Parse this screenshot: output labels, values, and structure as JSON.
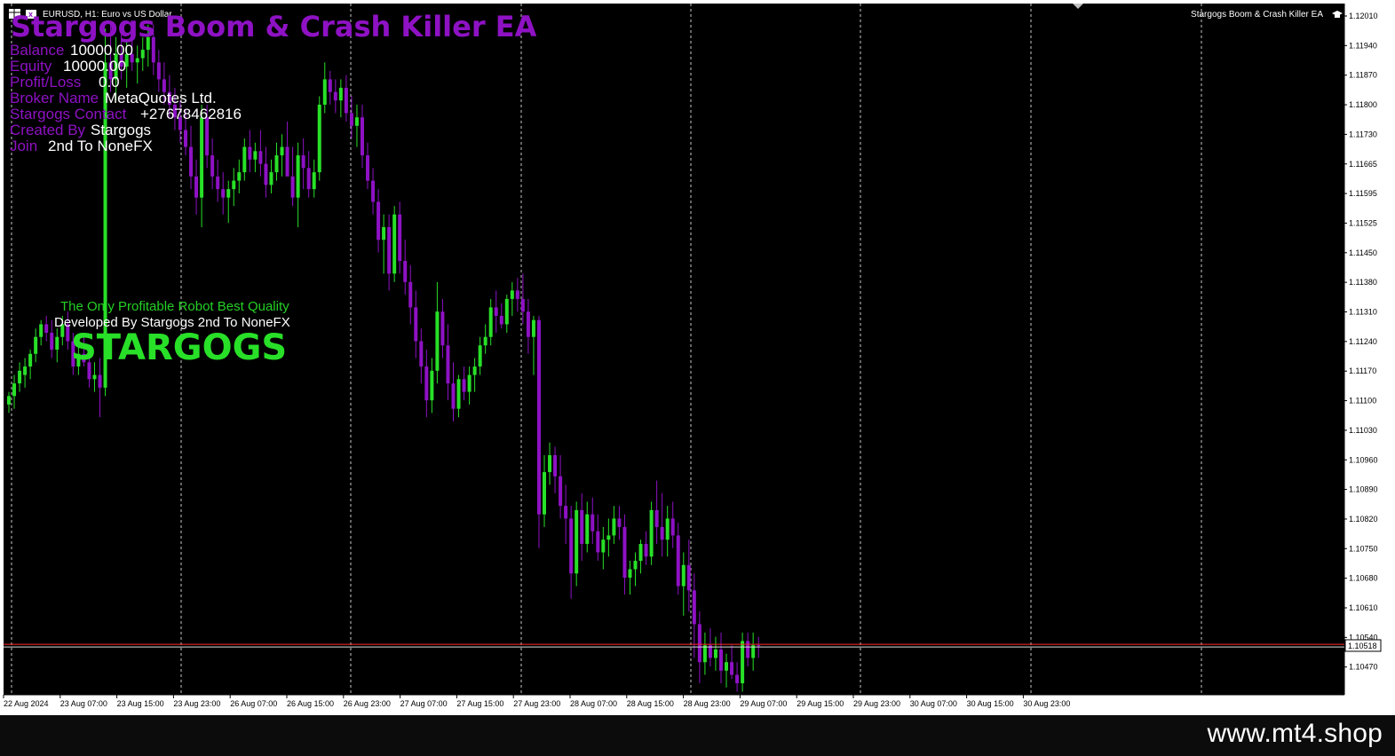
{
  "chart_header": {
    "symbol_label": "EURUSD, H1:  Euro vs US Dollar",
    "ea_name": "Stargogs Boom & Crash Killer EA"
  },
  "ea_panel": {
    "title": "Stargogs Boom & Crash Killer EA",
    "rows": [
      {
        "label": "Balance",
        "value": "10000.00"
      },
      {
        "label": "Equity",
        "value": "10000.00"
      },
      {
        "label": "Profit/Loss",
        "value": "0.0"
      },
      {
        "label": "Broker Name",
        "value": "MetaQuotes Ltd."
      },
      {
        "label": "Stargogs Contact",
        "value": "+27678462816"
      },
      {
        "label": "Created By",
        "value": "Stargogs"
      },
      {
        "label": "Join",
        "value": "2nd To NoneFX"
      }
    ]
  },
  "banner": {
    "line1": "The Only Profitable Robot Best Quality",
    "line2": "Developed By Stargogs 2nd To NoneFX",
    "big": "STARGOGS"
  },
  "colors": {
    "background": "#000000",
    "bull": "#28e028",
    "bear": "#8e12c4",
    "current_price_line": "#ff2a2a",
    "grid": "#c8c8c8"
  },
  "current_price": "1.10518",
  "watermark": "www.mt4.shop",
  "chart_data": {
    "type": "candlestick",
    "symbol": "EURUSD",
    "timeframe": "H1",
    "y_ticks": [
      "1.12010",
      "1.11940",
      "1.11870",
      "1.11800",
      "1.11730",
      "1.11665",
      "1.11595",
      "1.11525",
      "1.11450",
      "1.11380",
      "1.11310",
      "1.11240",
      "1.11170",
      "1.11100",
      "1.11030",
      "1.10960",
      "1.10890",
      "1.10820",
      "1.10750",
      "1.10680",
      "1.10610",
      "1.10540",
      "1.10470"
    ],
    "ylim": [
      1.1043,
      1.1204
    ],
    "x_ticks": [
      "22 Aug 2024",
      "23 Aug 07:00",
      "23 Aug 15:00",
      "23 Aug 23:00",
      "26 Aug 07:00",
      "26 Aug 15:00",
      "26 Aug 23:00",
      "27 Aug 07:00",
      "27 Aug 15:00",
      "27 Aug 23:00",
      "28 Aug 07:00",
      "28 Aug 15:00",
      "28 Aug 23:00",
      "29 Aug 07:00",
      "29 Aug 15:00",
      "29 Aug 23:00",
      "30 Aug 07:00",
      "30 Aug 15:00",
      "30 Aug 23:00"
    ],
    "current_price": 1.10518,
    "series": [
      {
        "name": "EURUSD H1",
        "ohlc": [
          [
            1.1109,
            1.1112,
            1.1107,
            1.1111
          ],
          [
            1.1111,
            1.1116,
            1.1108,
            1.1114
          ],
          [
            1.1114,
            1.1119,
            1.1112,
            1.1117
          ],
          [
            1.1116,
            1.112,
            1.1113,
            1.1118
          ],
          [
            1.1118,
            1.1122,
            1.1115,
            1.1121
          ],
          [
            1.1121,
            1.1127,
            1.1119,
            1.1125
          ],
          [
            1.1125,
            1.1129,
            1.1123,
            1.1128
          ],
          [
            1.1128,
            1.113,
            1.1124,
            1.1126
          ],
          [
            1.1126,
            1.1129,
            1.112,
            1.1122
          ],
          [
            1.1122,
            1.1127,
            1.1119,
            1.1125
          ],
          [
            1.1125,
            1.113,
            1.1123,
            1.1128
          ],
          [
            1.1128,
            1.1131,
            1.1122,
            1.1124
          ],
          [
            1.1124,
            1.1126,
            1.1116,
            1.1118
          ],
          [
            1.1118,
            1.1123,
            1.1116,
            1.1121
          ],
          [
            1.1121,
            1.1125,
            1.1118,
            1.1119
          ],
          [
            1.1119,
            1.1122,
            1.1113,
            1.1115
          ],
          [
            1.1115,
            1.1119,
            1.1112,
            1.1116
          ],
          [
            1.1116,
            1.112,
            1.1106,
            1.1113
          ],
          [
            1.1113,
            1.1198,
            1.1111,
            1.119
          ],
          [
            1.119,
            1.1199,
            1.1183,
            1.1186
          ],
          [
            1.1186,
            1.1196,
            1.1181,
            1.1192
          ],
          [
            1.1192,
            1.1197,
            1.1186,
            1.1189
          ],
          [
            1.1189,
            1.1195,
            1.1184,
            1.1192
          ],
          [
            1.1192,
            1.1197,
            1.1188,
            1.119
          ],
          [
            1.119,
            1.1194,
            1.1185,
            1.1191
          ],
          [
            1.1191,
            1.1196,
            1.1188,
            1.1193
          ],
          [
            1.1193,
            1.1199,
            1.1189,
            1.1196
          ],
          [
            1.1196,
            1.1199,
            1.1187,
            1.119
          ],
          [
            1.119,
            1.1193,
            1.1183,
            1.1186
          ],
          [
            1.1186,
            1.119,
            1.118,
            1.1183
          ],
          [
            1.1183,
            1.1187,
            1.1177,
            1.118
          ],
          [
            1.118,
            1.1184,
            1.1174,
            1.1177
          ],
          [
            1.1177,
            1.1181,
            1.1171,
            1.1174
          ],
          [
            1.1174,
            1.1179,
            1.1168,
            1.117
          ],
          [
            1.117,
            1.1175,
            1.116,
            1.1163
          ],
          [
            1.1163,
            1.1167,
            1.1154,
            1.1158
          ],
          [
            1.1158,
            1.118,
            1.1151,
            1.1177
          ],
          [
            1.1177,
            1.118,
            1.1165,
            1.1168
          ],
          [
            1.1168,
            1.1172,
            1.116,
            1.1163
          ],
          [
            1.1163,
            1.1167,
            1.1157,
            1.116
          ],
          [
            1.116,
            1.1164,
            1.1154,
            1.1158
          ],
          [
            1.1158,
            1.1162,
            1.1152,
            1.116
          ],
          [
            1.116,
            1.1165,
            1.1156,
            1.1162
          ],
          [
            1.1162,
            1.1167,
            1.1159,
            1.1164
          ],
          [
            1.1164,
            1.1172,
            1.1162,
            1.117
          ],
          [
            1.117,
            1.1174,
            1.1164,
            1.1167
          ],
          [
            1.1167,
            1.1171,
            1.1164,
            1.1169
          ],
          [
            1.1169,
            1.1174,
            1.1163,
            1.1166
          ],
          [
            1.1166,
            1.117,
            1.1158,
            1.1161
          ],
          [
            1.1161,
            1.1167,
            1.1159,
            1.1164
          ],
          [
            1.1164,
            1.1171,
            1.1162,
            1.1168
          ],
          [
            1.1168,
            1.1173,
            1.1163,
            1.117
          ],
          [
            1.117,
            1.1176,
            1.1166,
            1.1163
          ],
          [
            1.1163,
            1.117,
            1.1156,
            1.1158
          ],
          [
            1.1158,
            1.1171,
            1.1151,
            1.1168
          ],
          [
            1.1168,
            1.1172,
            1.116,
            1.1165
          ],
          [
            1.1165,
            1.1169,
            1.1158,
            1.116
          ],
          [
            1.116,
            1.1167,
            1.1158,
            1.1164
          ],
          [
            1.1164,
            1.1182,
            1.1162,
            1.118
          ],
          [
            1.118,
            1.119,
            1.1178,
            1.1186
          ],
          [
            1.1186,
            1.1188,
            1.118,
            1.1183
          ],
          [
            1.1183,
            1.1186,
            1.1178,
            1.1181
          ],
          [
            1.1181,
            1.1186,
            1.1177,
            1.1184
          ],
          [
            1.1184,
            1.1187,
            1.1176,
            1.1178
          ],
          [
            1.1178,
            1.1182,
            1.1172,
            1.1175
          ],
          [
            1.1175,
            1.118,
            1.117,
            1.1177
          ],
          [
            1.1177,
            1.118,
            1.1165,
            1.1168
          ],
          [
            1.1168,
            1.1171,
            1.116,
            1.1162
          ],
          [
            1.1162,
            1.1165,
            1.1154,
            1.1157
          ],
          [
            1.1157,
            1.116,
            1.1145,
            1.1148
          ],
          [
            1.1148,
            1.1154,
            1.114,
            1.1151
          ],
          [
            1.1151,
            1.1154,
            1.1136,
            1.114
          ],
          [
            1.114,
            1.1156,
            1.1138,
            1.1154
          ],
          [
            1.1154,
            1.1157,
            1.114,
            1.1143
          ],
          [
            1.1143,
            1.1148,
            1.1135,
            1.1138
          ],
          [
            1.1138,
            1.1142,
            1.1128,
            1.1132
          ],
          [
            1.1132,
            1.1136,
            1.112,
            1.1124
          ],
          [
            1.1124,
            1.1127,
            1.1114,
            1.1118
          ],
          [
            1.1118,
            1.1122,
            1.1106,
            1.111
          ],
          [
            1.111,
            1.112,
            1.1107,
            1.1117
          ],
          [
            1.1117,
            1.1138,
            1.1114,
            1.1131
          ],
          [
            1.1131,
            1.1134,
            1.112,
            1.1123
          ],
          [
            1.1123,
            1.1128,
            1.111,
            1.1114
          ],
          [
            1.1114,
            1.1119,
            1.1105,
            1.1108
          ],
          [
            1.1108,
            1.1116,
            1.1106,
            1.1115
          ],
          [
            1.1115,
            1.1118,
            1.111,
            1.1112
          ],
          [
            1.1112,
            1.1118,
            1.1109,
            1.1116
          ],
          [
            1.1116,
            1.112,
            1.1112,
            1.1118
          ],
          [
            1.1118,
            1.1125,
            1.1116,
            1.1123
          ],
          [
            1.1123,
            1.1128,
            1.1121,
            1.1125
          ],
          [
            1.1125,
            1.1134,
            1.1123,
            1.1132
          ],
          [
            1.1132,
            1.1136,
            1.1126,
            1.113
          ],
          [
            1.113,
            1.1133,
            1.1127,
            1.1128
          ],
          [
            1.1128,
            1.1135,
            1.1126,
            1.1134
          ],
          [
            1.1134,
            1.1138,
            1.113,
            1.1136
          ],
          [
            1.1136,
            1.1139,
            1.1131,
            1.1134
          ],
          [
            1.1134,
            1.114,
            1.1128,
            1.1131
          ],
          [
            1.1131,
            1.1134,
            1.1121,
            1.1125
          ],
          [
            1.1125,
            1.113,
            1.1116,
            1.1129
          ],
          [
            1.1129,
            1.113,
            1.1075,
            1.1083
          ],
          [
            1.1083,
            1.1097,
            1.108,
            1.1093
          ],
          [
            1.1093,
            1.11,
            1.109,
            1.1097
          ],
          [
            1.1097,
            1.1099,
            1.1088,
            1.1092
          ],
          [
            1.1092,
            1.1097,
            1.1082,
            1.1085
          ],
          [
            1.1085,
            1.109,
            1.1076,
            1.1082
          ],
          [
            1.1082,
            1.1085,
            1.1063,
            1.1069
          ],
          [
            1.1069,
            1.1086,
            1.1066,
            1.1084
          ],
          [
            1.1084,
            1.1088,
            1.1072,
            1.1076
          ],
          [
            1.1076,
            1.1086,
            1.1074,
            1.1083
          ],
          [
            1.1083,
            1.1087,
            1.1076,
            1.1079
          ],
          [
            1.1079,
            1.1083,
            1.1072,
            1.1074
          ],
          [
            1.1074,
            1.108,
            1.107,
            1.1077
          ],
          [
            1.1077,
            1.1082,
            1.1073,
            1.1078
          ],
          [
            1.1078,
            1.1085,
            1.1076,
            1.1082
          ],
          [
            1.1082,
            1.1085,
            1.1077,
            1.108
          ],
          [
            1.108,
            1.1083,
            1.1064,
            1.1068
          ],
          [
            1.1068,
            1.1072,
            1.1064,
            1.107
          ],
          [
            1.107,
            1.1074,
            1.1066,
            1.1072
          ],
          [
            1.1072,
            1.1077,
            1.1069,
            1.1076
          ],
          [
            1.1076,
            1.1079,
            1.1071,
            1.1073
          ],
          [
            1.1073,
            1.1086,
            1.1071,
            1.1084
          ],
          [
            1.1084,
            1.1091,
            1.1076,
            1.108
          ],
          [
            1.108,
            1.1088,
            1.1073,
            1.1077
          ],
          [
            1.1077,
            1.1085,
            1.1073,
            1.1082
          ],
          [
            1.1082,
            1.1086,
            1.1075,
            1.1078
          ],
          [
            1.1078,
            1.1081,
            1.1064,
            1.1066
          ],
          [
            1.1066,
            1.1074,
            1.1059,
            1.1071
          ],
          [
            1.1071,
            1.1077,
            1.106,
            1.1065
          ],
          [
            1.1065,
            1.1069,
            1.1049,
            1.1057
          ],
          [
            1.1057,
            1.106,
            1.1043,
            1.1048
          ],
          [
            1.1048,
            1.1055,
            1.1045,
            1.1052
          ],
          [
            1.1052,
            1.1056,
            1.1047,
            1.1049
          ],
          [
            1.1049,
            1.1054,
            1.1046,
            1.1051
          ],
          [
            1.1051,
            1.1055,
            1.1043,
            1.1046
          ],
          [
            1.1046,
            1.105,
            1.1042,
            1.1048
          ],
          [
            1.1048,
            1.1052,
            1.1044,
            1.1045
          ],
          [
            1.1045,
            1.1048,
            1.1041,
            1.1043
          ],
          [
            1.1043,
            1.1055,
            1.1041,
            1.1053
          ],
          [
            1.1053,
            1.1055,
            1.1047,
            1.1049
          ],
          [
            1.1049,
            1.1055,
            1.1046,
            1.1052
          ],
          [
            1.1052,
            1.1054,
            1.1049,
            1.10518
          ]
        ]
      }
    ]
  }
}
